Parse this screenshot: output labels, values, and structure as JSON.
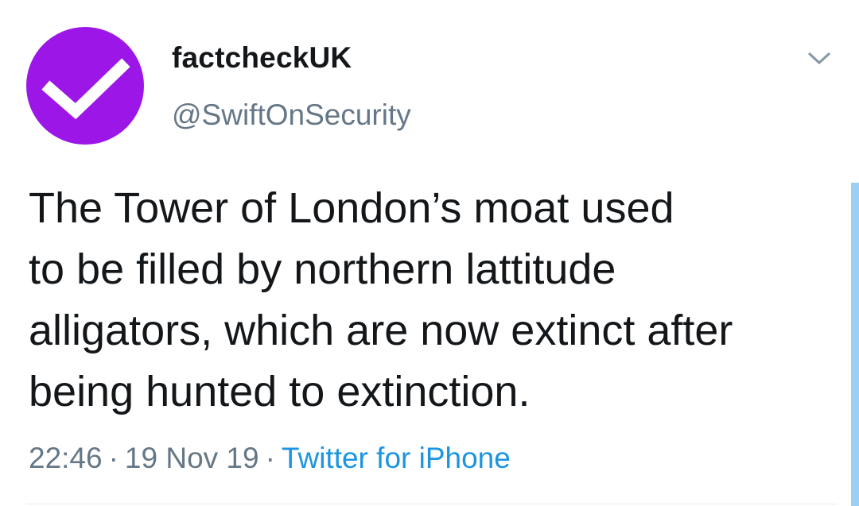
{
  "tweet": {
    "author": {
      "display_name": "factcheckUK",
      "handle": "@SwiftOnSecurity",
      "avatar_icon": "checkmark-icon",
      "avatar_color": "#9c16e8"
    },
    "text_lines": [
      "The Tower of London’s moat used",
      "to be filled by northern lattitude",
      "alligators, which are now extinct after",
      "being hunted to extinction."
    ],
    "time": "22:46",
    "date": "19 Nov 19",
    "separator": "·",
    "source": "Twitter for iPhone",
    "source_color": "#1b95e0",
    "menu_icon": "chevron-down-icon"
  }
}
